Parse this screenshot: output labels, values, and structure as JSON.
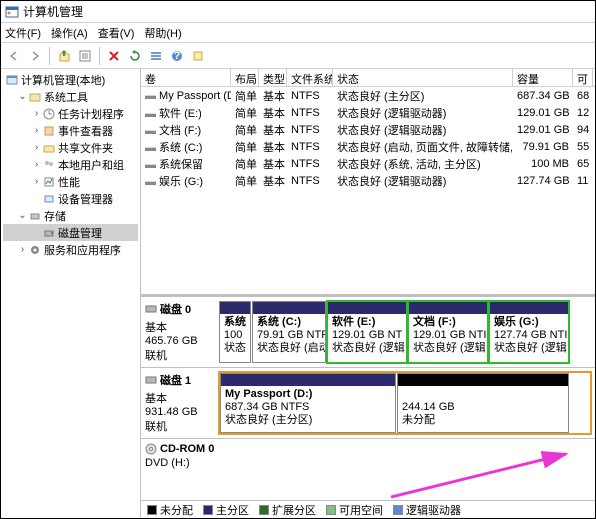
{
  "window": {
    "title": "计算机管理"
  },
  "menu": {
    "file": "文件(F)",
    "action": "操作(A)",
    "view": "查看(V)",
    "help": "帮助(H)"
  },
  "tree": {
    "root": "计算机管理(本地)",
    "systools": "系统工具",
    "task": "任务计划程序",
    "event": "事件查看器",
    "shared": "共享文件夹",
    "users": "本地用户和组",
    "perf": "性能",
    "devmgr": "设备管理器",
    "storage": "存储",
    "diskmgmt": "磁盘管理",
    "services": "服务和应用程序"
  },
  "columns": {
    "vol": "卷",
    "layout": "布局",
    "type": "类型",
    "fs": "文件系统",
    "status": "状态",
    "cap": "容量",
    "avail": "可"
  },
  "volumes": [
    {
      "name": "My Passport (D:)",
      "layout": "简单",
      "type": "基本",
      "fs": "NTFS",
      "status": "状态良好 (主分区)",
      "cap": "687.34 GB",
      "avail": "68"
    },
    {
      "name": "软件 (E:)",
      "layout": "简单",
      "type": "基本",
      "fs": "NTFS",
      "status": "状态良好 (逻辑驱动器)",
      "cap": "129.01 GB",
      "avail": "12"
    },
    {
      "name": "文档 (F:)",
      "layout": "简单",
      "type": "基本",
      "fs": "NTFS",
      "status": "状态良好 (逻辑驱动器)",
      "cap": "129.01 GB",
      "avail": "94"
    },
    {
      "name": "系统 (C:)",
      "layout": "简单",
      "type": "基本",
      "fs": "NTFS",
      "status": "状态良好 (启动, 页面文件, 故障转储, 主分区)",
      "cap": "79.91 GB",
      "avail": "55"
    },
    {
      "name": "系统保留",
      "layout": "简单",
      "type": "基本",
      "fs": "NTFS",
      "status": "状态良好 (系统, 活动, 主分区)",
      "cap": "100 MB",
      "avail": "65"
    },
    {
      "name": "娱乐 (G:)",
      "layout": "简单",
      "type": "基本",
      "fs": "NTFS",
      "status": "状态良好 (逻辑驱动器)",
      "cap": "127.74 GB",
      "avail": "11"
    }
  ],
  "disks": {
    "d0": {
      "title": "磁盘 0",
      "sub1": "基本",
      "sub2": "465.76 GB",
      "sub3": "联机",
      "p0": {
        "name": "系统",
        "l2": "100",
        "l3": "状态"
      },
      "p1": {
        "name": "系统  (C:)",
        "l2": "79.91 GB NTF",
        "l3": "状态良好 (启动"
      },
      "p2": {
        "name": "软件  (E:)",
        "l2": "129.01 GB NT",
        "l3": "状态良好 (逻辑"
      },
      "p3": {
        "name": "文档  (F:)",
        "l2": "129.01 GB NTI",
        "l3": "状态良好 (逻辑"
      },
      "p4": {
        "name": "娱乐  (G:)",
        "l2": "127.74 GB NTI",
        "l3": "状态良好 (逻辑"
      }
    },
    "d1": {
      "title": "磁盘 1",
      "sub1": "基本",
      "sub2": "931.48 GB",
      "sub3": "联机",
      "p0": {
        "name": "My Passport  (D:)",
        "l2": "687.34 GB NTFS",
        "l3": "状态良好 (主分区)"
      },
      "p1": {
        "l2": "244.14 GB",
        "l3": "未分配"
      }
    },
    "cd": {
      "title": "CD-ROM 0",
      "sub1": "DVD (H:)"
    }
  },
  "legend": {
    "unalloc": "未分配",
    "primary": "主分区",
    "ext": "扩展分区",
    "free": "可用空间",
    "logical": "逻辑驱动器"
  }
}
